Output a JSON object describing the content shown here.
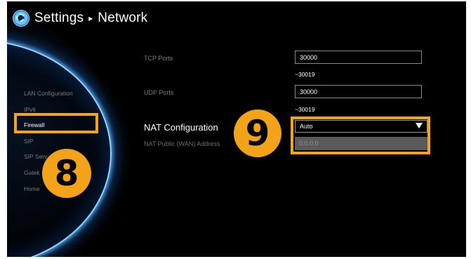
{
  "header": {
    "section": "Settings",
    "separator": "▸",
    "page": "Network",
    "icon": "settings-gear-icon"
  },
  "sidebar": {
    "items": [
      {
        "label": "LAN Configuration"
      },
      {
        "label": "IPv6"
      },
      {
        "label": "Firewall",
        "selected": true
      },
      {
        "label": "SIP"
      },
      {
        "label": "SIP Serv"
      },
      {
        "label": "Gatek"
      },
      {
        "label": "Home"
      }
    ]
  },
  "callouts": {
    "left_number": "8",
    "right_number": "9",
    "color": "#f2a51a"
  },
  "form": {
    "tcp_ports": {
      "label": "TCP Ports",
      "value": "30000",
      "range_end": "~30019"
    },
    "udp_ports": {
      "label": "UDP Ports",
      "value": "30000",
      "range_end": "~30019"
    },
    "nat_configuration": {
      "label": "NAT Configuration",
      "value": "Auto"
    },
    "nat_public_address": {
      "label": "NAT Public (WAN) Address",
      "value": "0.0.0.0"
    }
  },
  "colors": {
    "accent": "#f2a51a",
    "glow": "#5ab4ff",
    "background": "#000000"
  }
}
